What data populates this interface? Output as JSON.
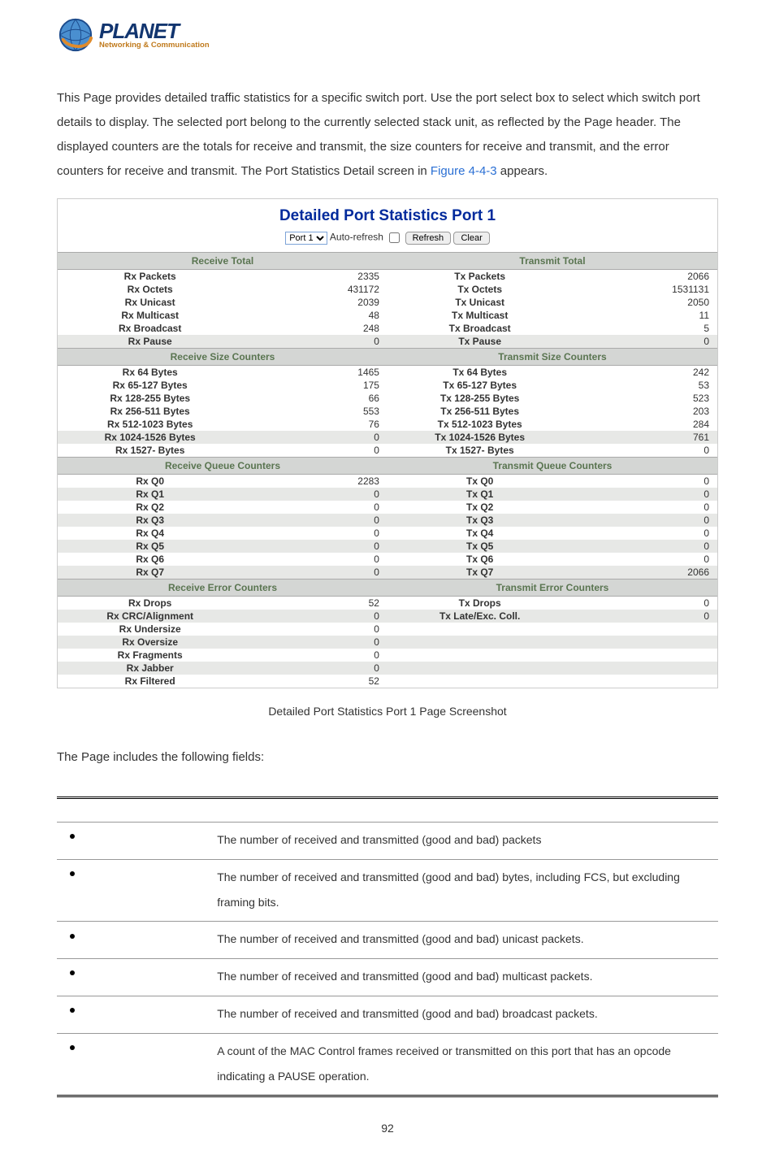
{
  "logo": {
    "main": "PLANET",
    "sub": "Networking & Communication"
  },
  "intro": {
    "text_before": "This Page provides detailed traffic statistics for a specific switch port. Use the port select box to select which switch port details to display. The selected port belong to the currently selected stack unit, as reflected by the Page header. The displayed counters are the totals for receive and transmit, the size counters for receive and transmit, and the error counters for receive and transmit. The Port Statistics Detail screen in ",
    "link": "Figure 4-4-3",
    "text_after": " appears."
  },
  "screenshot": {
    "title": "Detailed Port Statistics  Port 1",
    "controls": {
      "port_value": "Port 1",
      "auto_refresh_label": "Auto-refresh",
      "refresh": "Refresh",
      "clear": "Clear"
    },
    "sections": [
      {
        "rx_header": "Receive Total",
        "tx_header": "Transmit Total",
        "rows": [
          {
            "rx_label": "Rx Packets",
            "rx_val": "2335",
            "tx_label": "Tx Packets",
            "tx_val": "2066",
            "alt": false
          },
          {
            "rx_label": "Rx Octets",
            "rx_val": "431172",
            "tx_label": "Tx Octets",
            "tx_val": "1531131",
            "alt": false
          },
          {
            "rx_label": "Rx Unicast",
            "rx_val": "2039",
            "tx_label": "Tx Unicast",
            "tx_val": "2050",
            "alt": false
          },
          {
            "rx_label": "Rx Multicast",
            "rx_val": "48",
            "tx_label": "Tx Multicast",
            "tx_val": "11",
            "alt": false
          },
          {
            "rx_label": "Rx Broadcast",
            "rx_val": "248",
            "tx_label": "Tx Broadcast",
            "tx_val": "5",
            "alt": false
          },
          {
            "rx_label": "Rx Pause",
            "rx_val": "0",
            "tx_label": "Tx Pause",
            "tx_val": "0",
            "alt": true
          }
        ]
      },
      {
        "rx_header": "Receive Size Counters",
        "tx_header": "Transmit Size Counters",
        "rows": [
          {
            "rx_label": "Rx 64 Bytes",
            "rx_val": "1465",
            "tx_label": "Tx 64 Bytes",
            "tx_val": "242",
            "alt": false
          },
          {
            "rx_label": "Rx 65-127 Bytes",
            "rx_val": "175",
            "tx_label": "Tx 65-127 Bytes",
            "tx_val": "53",
            "alt": false
          },
          {
            "rx_label": "Rx 128-255 Bytes",
            "rx_val": "66",
            "tx_label": "Tx 128-255 Bytes",
            "tx_val": "523",
            "alt": false
          },
          {
            "rx_label": "Rx 256-511 Bytes",
            "rx_val": "553",
            "tx_label": "Tx 256-511 Bytes",
            "tx_val": "203",
            "alt": false
          },
          {
            "rx_label": "Rx 512-1023 Bytes",
            "rx_val": "76",
            "tx_label": "Tx 512-1023 Bytes",
            "tx_val": "284",
            "alt": false
          },
          {
            "rx_label": "Rx 1024-1526 Bytes",
            "rx_val": "0",
            "tx_label": "Tx 1024-1526 Bytes",
            "tx_val": "761",
            "alt": true
          },
          {
            "rx_label": "Rx 1527- Bytes",
            "rx_val": "0",
            "tx_label": "Tx 1527- Bytes",
            "tx_val": "0",
            "alt": false
          }
        ]
      },
      {
        "rx_header": "Receive Queue Counters",
        "tx_header": "Transmit Queue Counters",
        "rows": [
          {
            "rx_label": "Rx Q0",
            "rx_val": "2283",
            "tx_label": "Tx Q0",
            "tx_val": "0",
            "alt": false
          },
          {
            "rx_label": "Rx Q1",
            "rx_val": "0",
            "tx_label": "Tx Q1",
            "tx_val": "0",
            "alt": true
          },
          {
            "rx_label": "Rx Q2",
            "rx_val": "0",
            "tx_label": "Tx Q2",
            "tx_val": "0",
            "alt": false
          },
          {
            "rx_label": "Rx Q3",
            "rx_val": "0",
            "tx_label": "Tx Q3",
            "tx_val": "0",
            "alt": true
          },
          {
            "rx_label": "Rx Q4",
            "rx_val": "0",
            "tx_label": "Tx Q4",
            "tx_val": "0",
            "alt": false
          },
          {
            "rx_label": "Rx Q5",
            "rx_val": "0",
            "tx_label": "Tx Q5",
            "tx_val": "0",
            "alt": true
          },
          {
            "rx_label": "Rx Q6",
            "rx_val": "0",
            "tx_label": "Tx Q6",
            "tx_val": "0",
            "alt": false
          },
          {
            "rx_label": "Rx Q7",
            "rx_val": "0",
            "tx_label": "Tx Q7",
            "tx_val": "2066",
            "alt": true
          }
        ]
      },
      {
        "rx_header": "Receive Error Counters",
        "tx_header": "Transmit Error Counters",
        "rows": [
          {
            "rx_label": "Rx Drops",
            "rx_val": "52",
            "tx_label": "Tx Drops",
            "tx_val": "0",
            "alt": false
          },
          {
            "rx_label": "Rx CRC/Alignment",
            "rx_val": "0",
            "tx_label": "Tx Late/Exc. Coll.",
            "tx_val": "0",
            "alt": true
          },
          {
            "rx_label": "Rx Undersize",
            "rx_val": "0",
            "tx_label": "",
            "tx_val": "",
            "alt": false
          },
          {
            "rx_label": "Rx Oversize",
            "rx_val": "0",
            "tx_label": "",
            "tx_val": "",
            "alt": true
          },
          {
            "rx_label": "Rx Fragments",
            "rx_val": "0",
            "tx_label": "",
            "tx_val": "",
            "alt": false
          },
          {
            "rx_label": "Rx Jabber",
            "rx_val": "0",
            "tx_label": "",
            "tx_val": "",
            "alt": true
          },
          {
            "rx_label": "Rx Filtered",
            "rx_val": "52",
            "tx_label": "",
            "tx_val": "",
            "alt": false
          }
        ]
      }
    ]
  },
  "caption": "Detailed Port Statistics Port 1 Page Screenshot",
  "fields_intro": "The Page includes the following fields:",
  "fields": [
    {
      "desc": "The number of received and transmitted (good and bad) packets"
    },
    {
      "desc": "The number of received and transmitted (good and bad) bytes, including FCS, but excluding framing bits."
    },
    {
      "desc": "The number of received and transmitted (good and bad) unicast packets."
    },
    {
      "desc": "The number of received and transmitted (good and bad) multicast packets."
    },
    {
      "desc": "The number of received and transmitted (good and bad) broadcast packets."
    },
    {
      "desc": "A count of the MAC Control frames received or transmitted on this port that has an opcode indicating a PAUSE operation."
    }
  ],
  "page_number": "92"
}
